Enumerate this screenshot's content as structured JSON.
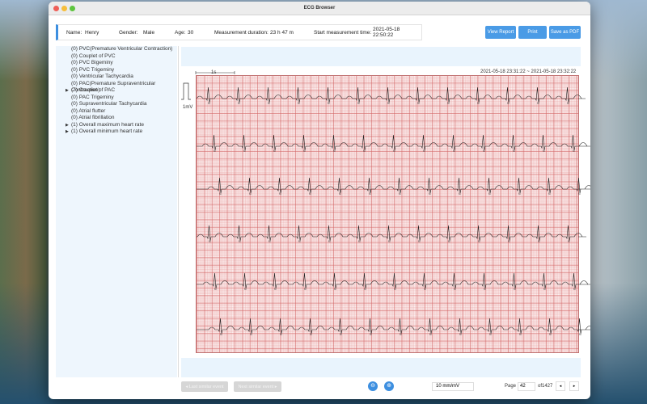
{
  "window": {
    "title": "ECG Browser"
  },
  "patient": {
    "name_label": "Name:",
    "name": "Henry",
    "gender_label": "Gender:",
    "gender": "Male",
    "age_label": "Age:",
    "age": "30",
    "duration_label": "Measurement duration:",
    "duration": "23 h 47 m",
    "start_label": "Start measurement time:",
    "start": "2021-05-18 22:50:22"
  },
  "toolbar": {
    "view_report": "View Report",
    "print": "Print",
    "save_pdf": "Save as PDF"
  },
  "events": [
    {
      "label": "(0) PVC(Premature Ventricular Contraction)",
      "expandable": false
    },
    {
      "label": "(0) Couplet of PVC",
      "expandable": false
    },
    {
      "label": "(0) PVC Bigeminy",
      "expandable": false
    },
    {
      "label": "(0) PVC Trigeminy",
      "expandable": false
    },
    {
      "label": "(0) Ventricular Tachycardia",
      "expandable": false
    },
    {
      "label": "(0) PAC(Premature Supraventricular Contraction)",
      "expandable": false
    },
    {
      "label": "(7) Couplet of PAC",
      "expandable": true
    },
    {
      "label": "(0) PAC Trigeminy",
      "expandable": false
    },
    {
      "label": "(0) Supraventricular Tachycardia",
      "expandable": false
    },
    {
      "label": "(0) Atrial flutter",
      "expandable": false
    },
    {
      "label": "(0) Atrial fibrillation",
      "expandable": false
    },
    {
      "label": "(1) Overall maximum heart rate",
      "expandable": true
    },
    {
      "label": "(1) Overall minimum heart rate",
      "expandable": true
    }
  ],
  "ecg": {
    "scale_time": "1s",
    "scale_mv": "1mV",
    "range": "2021-05-18 23:31:22 ~ 2021-05-18 23:32:22",
    "beat_label": "N",
    "strips": 6
  },
  "footer": {
    "last_event": "◂ Last similar event",
    "next_event": "Next similar event ▸",
    "gain": "10 mm/mV",
    "page_label": "Page",
    "page": "42",
    "of_pages": "of1427",
    "prev": "◂",
    "next": "▸",
    "zoom_out": "⊖",
    "zoom_in": "⊕"
  },
  "colors": {
    "accent": "#4a9be6",
    "grid": "#d26464",
    "sidebar": "#eef6fd"
  }
}
